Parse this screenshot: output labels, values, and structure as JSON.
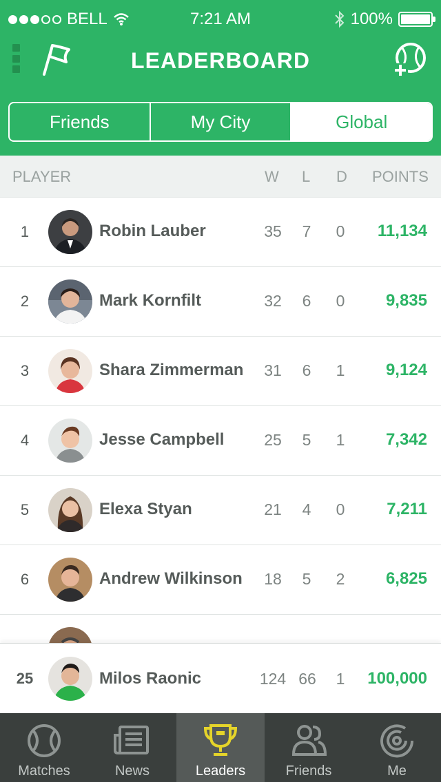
{
  "status_bar": {
    "carrier": "BELL",
    "time": "7:21 AM",
    "battery": "100%"
  },
  "nav": {
    "title": "LEADERBOARD"
  },
  "segments": [
    "Friends",
    "My City",
    "Global"
  ],
  "active_segment": "Global",
  "columns": {
    "player": "PLAYER",
    "w": "W",
    "l": "L",
    "d": "D",
    "points": "POINTS"
  },
  "players": [
    {
      "rank": "1",
      "name": "Robin Lauber",
      "w": "35",
      "l": "7",
      "d": "0",
      "points": "11,134"
    },
    {
      "rank": "2",
      "name": "Mark Kornfilt",
      "w": "32",
      "l": "6",
      "d": "0",
      "points": "9,835"
    },
    {
      "rank": "3",
      "name": "Shara Zimmerman",
      "w": "31",
      "l": "6",
      "d": "1",
      "points": "9,124"
    },
    {
      "rank": "4",
      "name": "Jesse Campbell",
      "w": "25",
      "l": "5",
      "d": "1",
      "points": "7,342"
    },
    {
      "rank": "5",
      "name": "Elexa Styan",
      "w": "21",
      "l": "4",
      "d": "0",
      "points": "7,211"
    },
    {
      "rank": "6",
      "name": "Andrew Wilkinson",
      "w": "18",
      "l": "5",
      "d": "2",
      "points": "6,825"
    }
  ],
  "my_entry": {
    "rank": "25",
    "name": "Milos Raonic",
    "w": "124",
    "l": "66",
    "d": "1",
    "points": "100,000"
  },
  "tabs": [
    {
      "label": "Matches",
      "icon": "tennis-ball-icon"
    },
    {
      "label": "News",
      "icon": "newspaper-icon"
    },
    {
      "label": "Leaders",
      "icon": "trophy-icon"
    },
    {
      "label": "Friends",
      "icon": "friends-icon"
    },
    {
      "label": "Me",
      "icon": "me-icon"
    }
  ],
  "active_tab": "Leaders",
  "colors": {
    "brand_green": "#2db466",
    "tabbar_bg": "#3a3f3d",
    "active_tab_bg": "#555a58",
    "trophy_yellow": "#e5d42a"
  }
}
